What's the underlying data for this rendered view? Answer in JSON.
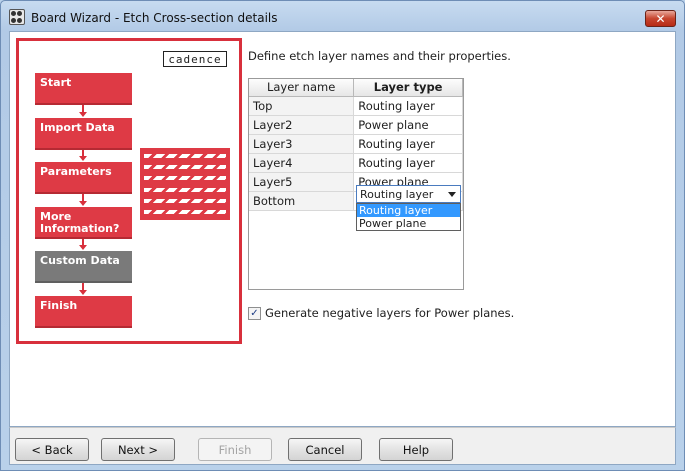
{
  "window": {
    "title": "Board Wizard - Etch Cross-section details",
    "close_glyph": "✕"
  },
  "sidebar": {
    "logo": "cadence",
    "steps": [
      {
        "label": "Start",
        "active": false
      },
      {
        "label": "Import Data",
        "active": false
      },
      {
        "label": "Parameters",
        "active": false
      },
      {
        "label": "More Information?",
        "active": false
      },
      {
        "label": "Custom Data",
        "active": true
      },
      {
        "label": "Finish",
        "active": false
      }
    ]
  },
  "main": {
    "instruction": "Define etch layer names and their properties.",
    "grid": {
      "columns": [
        "Layer name",
        "Layer type"
      ],
      "rows": [
        {
          "name": "Top",
          "type": "Routing layer"
        },
        {
          "name": "Layer2",
          "type": "Power plane"
        },
        {
          "name": "Layer3",
          "type": "Routing layer"
        },
        {
          "name": "Layer4",
          "type": "Routing layer"
        },
        {
          "name": "Layer5",
          "type": "Power plane"
        },
        {
          "name": "Bottom",
          "type": "Routing layer"
        }
      ],
      "editing_value": "Routing layer",
      "dropdown_options": [
        "Routing layer",
        "Power plane"
      ],
      "highlighted_option": "Routing layer"
    },
    "checkbox": {
      "label": "Generate negative layers for Power planes.",
      "checked": true,
      "check_glyph": "✓"
    }
  },
  "footer": {
    "back_label": "< Back",
    "next_label": "Next >",
    "finish_label": "Finish",
    "cancel_label": "Cancel",
    "help_label": "Help"
  }
}
